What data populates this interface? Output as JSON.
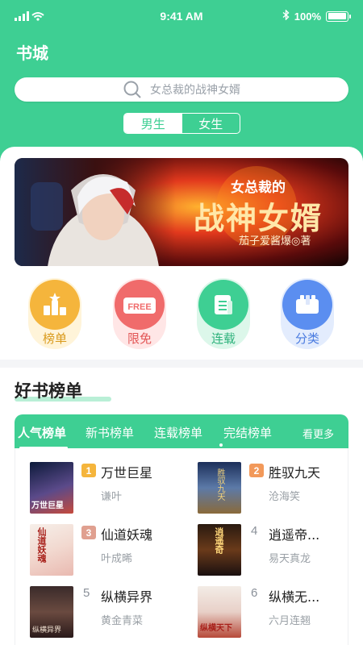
{
  "status_bar": {
    "time": "9:41 AM",
    "battery": "100%",
    "battery_level": 1.0
  },
  "header": {
    "title": "书城"
  },
  "search": {
    "placeholder": "女总裁的战神女婿",
    "icon": "search-icon"
  },
  "gender_tabs": [
    {
      "label": "男生",
      "selected": true
    },
    {
      "label": "女生",
      "selected": false
    }
  ],
  "banner": {
    "title": "女总裁的",
    "subtitle": "战神女婿",
    "author_line": "茄子爱酱爆◎著"
  },
  "categories": [
    {
      "label": "榜单",
      "icon": "rankings-icon",
      "color": "#f5b53c",
      "bg": "#fff4d9"
    },
    {
      "label": "限免",
      "icon": "free-tag-icon",
      "color": "#f06b6b",
      "bg": "#ffe6e6"
    },
    {
      "label": "连载",
      "icon": "serial-doc-icon",
      "color": "#3ecf93",
      "bg": "#dcf7ea"
    },
    {
      "label": "分类",
      "icon": "category-icon",
      "color": "#5b8ef0",
      "bg": "#e3ecfd"
    }
  ],
  "section": {
    "title": "好书榜单"
  },
  "rank_tabs": {
    "items": [
      "人气榜单",
      "新书榜单",
      "连载榜单",
      "完结榜单"
    ],
    "more": "看更多",
    "active_index": 0
  },
  "books": [
    {
      "rank": "1",
      "title": "万世巨星",
      "author": "谦叶",
      "cover_text": "万世巨星"
    },
    {
      "rank": "2",
      "title": "胜驭九天",
      "author": "沧海笑",
      "cover_text": "胜驭九天"
    },
    {
      "rank": "3",
      "title": "仙道妖魂",
      "author": "叶成晞",
      "cover_text": "仙道妖魂"
    },
    {
      "rank": "4",
      "title": "逍遥帝...",
      "author": "易天真龙",
      "cover_text": "逍遥奇"
    },
    {
      "rank": "5",
      "title": "纵横异界",
      "author": "黄金青菜",
      "cover_text": "纵横异界"
    },
    {
      "rank": "6",
      "title": "纵横无...",
      "author": "六月连翘",
      "cover_text": "纵横天下"
    }
  ],
  "colors": {
    "brand": "#3ecf93",
    "rank1": "#f5b53c",
    "rank2": "#f2995a",
    "rank3": "#e0a090"
  }
}
